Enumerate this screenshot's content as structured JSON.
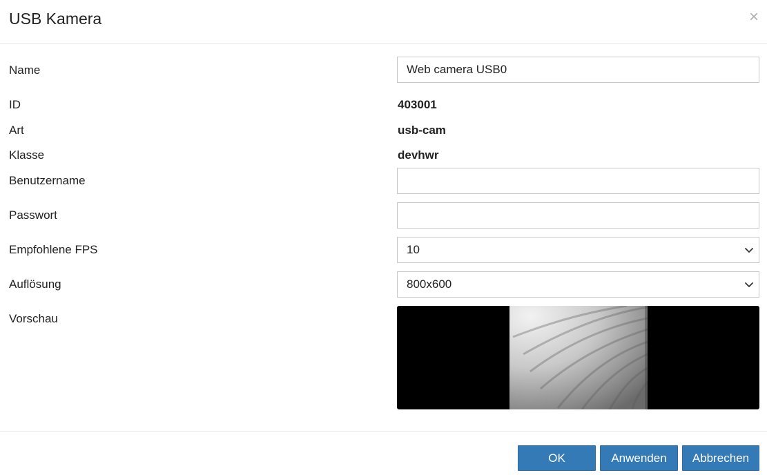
{
  "dialog": {
    "title": "USB Kamera",
    "close_glyph": "×"
  },
  "fields": {
    "name": {
      "label": "Name",
      "value": "Web camera USB0"
    },
    "id": {
      "label": "ID",
      "value": "403001"
    },
    "art": {
      "label": "Art",
      "value": "usb-cam"
    },
    "klasse": {
      "label": "Klasse",
      "value": "devhwr"
    },
    "username": {
      "label": "Benutzername",
      "value": ""
    },
    "password": {
      "label": "Passwort",
      "value": ""
    },
    "fps": {
      "label": "Empfohlene FPS",
      "selected": "10"
    },
    "resolution": {
      "label": "Auflösung",
      "selected": "800x600"
    },
    "preview": {
      "label": "Vorschau"
    }
  },
  "buttons": {
    "ok": "OK",
    "apply": "Anwenden",
    "cancel": "Abbrechen"
  },
  "icons": {
    "close": "close-icon",
    "select_arrow": "chevron-down-icon"
  },
  "colors": {
    "primary_button": "#337ab7",
    "preview_background": "#000000",
    "border": "#c8c8c8"
  }
}
